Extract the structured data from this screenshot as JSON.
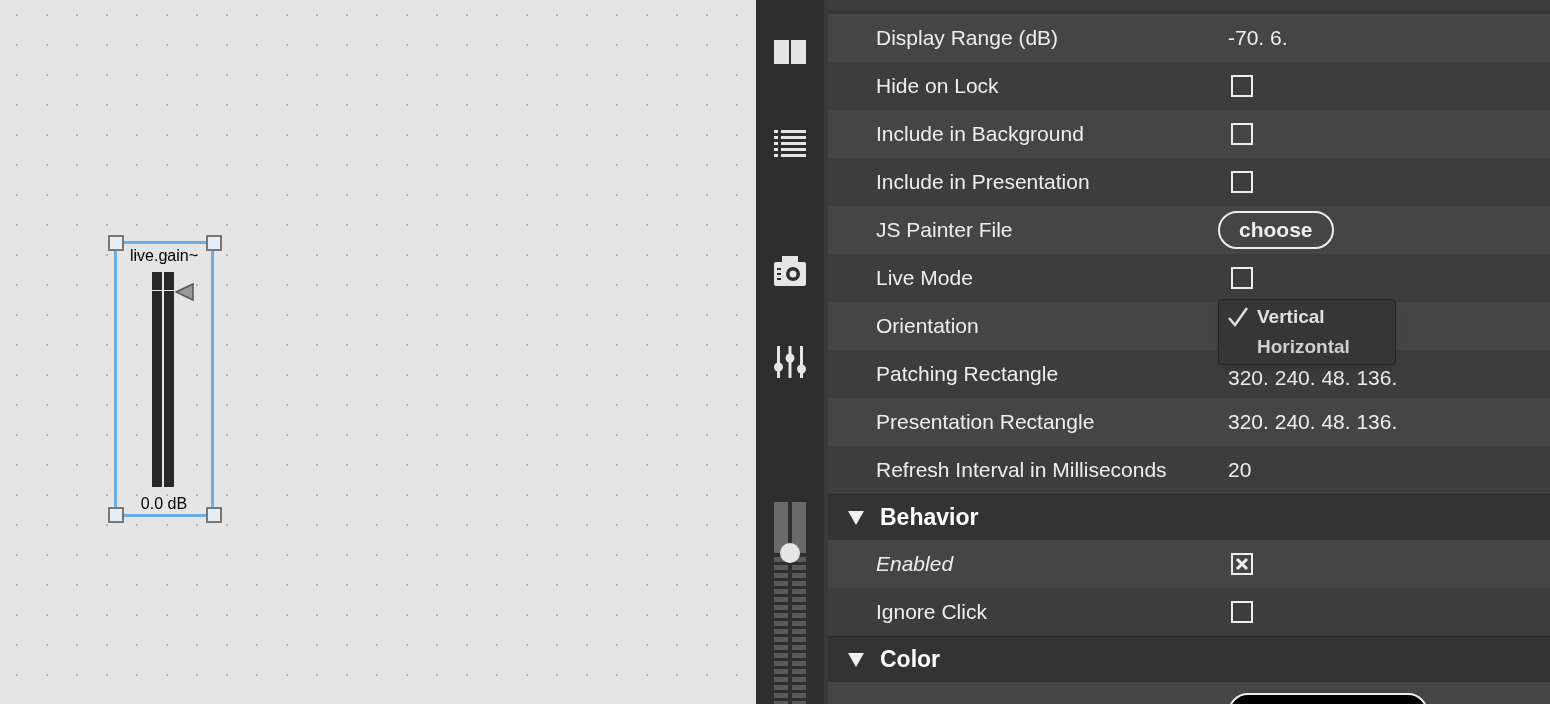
{
  "canvas": {
    "object": {
      "title": "live.gain~",
      "readout": "0.0 dB",
      "selected": true
    }
  },
  "sidebar": {
    "slider": {
      "level": 0.75
    }
  },
  "inspector": {
    "rows": [
      {
        "kind": "text",
        "label": "Display Range (dB)",
        "value": "-70. 6."
      },
      {
        "kind": "checkbox",
        "label": "Hide on Lock",
        "checked": false
      },
      {
        "kind": "checkbox",
        "label": "Include in Background",
        "checked": false
      },
      {
        "kind": "checkbox",
        "label": "Include in Presentation",
        "checked": false
      },
      {
        "kind": "button",
        "label": "JS Painter File",
        "button": "choose"
      },
      {
        "kind": "checkbox",
        "label": "Live Mode",
        "checked": false
      },
      {
        "kind": "menu",
        "label": "Orientation",
        "options": [
          {
            "label": "Vertical",
            "selected": true
          },
          {
            "label": "Horizontal",
            "selected": false
          }
        ]
      },
      {
        "kind": "text",
        "label": "Patching Rectangle",
        "value": "320. 240. 48. 136."
      },
      {
        "kind": "text",
        "label": "Presentation Rectangle",
        "value": "320. 240. 48. 136."
      },
      {
        "kind": "text",
        "label": "Refresh Interval in Milliseconds",
        "value": "20"
      },
      {
        "kind": "section",
        "label": "Behavior",
        "expanded": true
      },
      {
        "kind": "checkbox",
        "label": "Enabled",
        "checked": true,
        "italic": true
      },
      {
        "kind": "checkbox",
        "label": "Ignore Click",
        "checked": false
      },
      {
        "kind": "section",
        "label": "Color",
        "expanded": true
      },
      {
        "kind": "color",
        "color": "#000000"
      }
    ]
  }
}
